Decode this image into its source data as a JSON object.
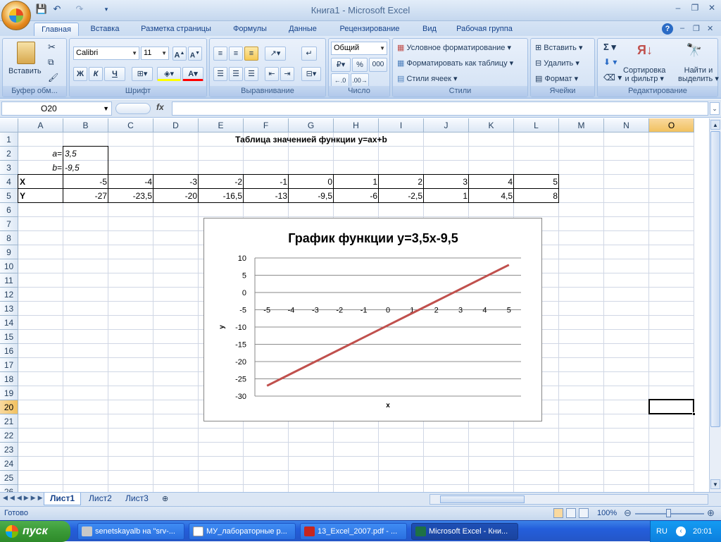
{
  "window": {
    "title": "Книга1 - Microsoft Excel"
  },
  "ribbon": {
    "tabs": [
      "Главная",
      "Вставка",
      "Разметка страницы",
      "Формулы",
      "Данные",
      "Рецензирование",
      "Вид",
      "Рабочая группа"
    ],
    "clipboard": {
      "paste": "Вставить",
      "label": "Буфер обм..."
    },
    "font": {
      "name": "Calibri",
      "size": "11",
      "bold": "Ж",
      "italic": "К",
      "underline": "Ч",
      "label": "Шрифт"
    },
    "alignment": {
      "label": "Выравнивание"
    },
    "number": {
      "format": "Общий",
      "percent": "%",
      "thousands": "000",
      "label": "Число"
    },
    "styles": {
      "conditional": "Условное форматирование",
      "table": "Форматировать как таблицу",
      "cell": "Стили ячеек",
      "label": "Стили"
    },
    "cells": {
      "insert": "Вставить",
      "delete": "Удалить",
      "format": "Формат",
      "label": "Ячейки"
    },
    "editing": {
      "sort_line1": "Сортировка",
      "sort_line2": "и фильтр",
      "find_line1": "Найти и",
      "find_line2": "выделить",
      "label": "Редактирование"
    }
  },
  "formula_bar": {
    "name_box": "O20",
    "fx": "fx",
    "formula": ""
  },
  "sheet": {
    "columns": [
      "A",
      "B",
      "C",
      "D",
      "E",
      "F",
      "G",
      "H",
      "I",
      "J",
      "K",
      "L",
      "M",
      "N",
      "O"
    ],
    "rows": [
      "1",
      "2",
      "3",
      "4",
      "5",
      "6",
      "7",
      "8",
      "9",
      "10",
      "11",
      "12",
      "13",
      "14",
      "15",
      "16",
      "17",
      "18",
      "19",
      "20",
      "21",
      "22",
      "23",
      "24",
      "25",
      "26"
    ],
    "selected_cell": "O20",
    "title": "Таблица значениeй функции y=ax+b",
    "a_label": "a=",
    "a_value": "3,5",
    "b_label": "b=",
    "b_value": "-9,5",
    "x_label": "X",
    "y_label": "Y",
    "x_values": [
      "-5",
      "-4",
      "-3",
      "-2",
      "-1",
      "0",
      "1",
      "2",
      "3",
      "4",
      "5"
    ],
    "y_values": [
      "-27",
      "-23,5",
      "-20",
      "-16,5",
      "-13",
      "-9,5",
      "-6",
      "-2,5",
      "1",
      "4,5",
      "8"
    ]
  },
  "chart_data": {
    "type": "line",
    "title": "График функции y=3,5x-9,5",
    "xlabel": "x",
    "ylabel": "y",
    "categories": [
      -5,
      -4,
      -3,
      -2,
      -1,
      0,
      1,
      2,
      3,
      4,
      5
    ],
    "series": [
      {
        "values": [
          -27,
          -23.5,
          -20,
          -16.5,
          -13,
          -9.5,
          -6,
          -2.5,
          1,
          4.5,
          8
        ],
        "color": "#c0504d"
      }
    ],
    "ylim": [
      -30,
      10
    ],
    "ytick_step": 5,
    "yticks": [
      "10",
      "5",
      "0",
      "-5",
      "-10",
      "-15",
      "-20",
      "-25",
      "-30"
    ],
    "grid": true,
    "legend": "none"
  },
  "sheet_tabs": [
    "Лист1",
    "Лист2",
    "Лист3"
  ],
  "status": {
    "ready": "Готово",
    "zoom": "100%"
  },
  "taskbar": {
    "start": "пуск",
    "items": [
      "senetskayalb на \"srv-...",
      "МУ_лабораторные р...",
      "13_Excel_2007.pdf - ...",
      "Microsoft Excel - Кни..."
    ],
    "lang": "RU",
    "time": "20:01"
  }
}
